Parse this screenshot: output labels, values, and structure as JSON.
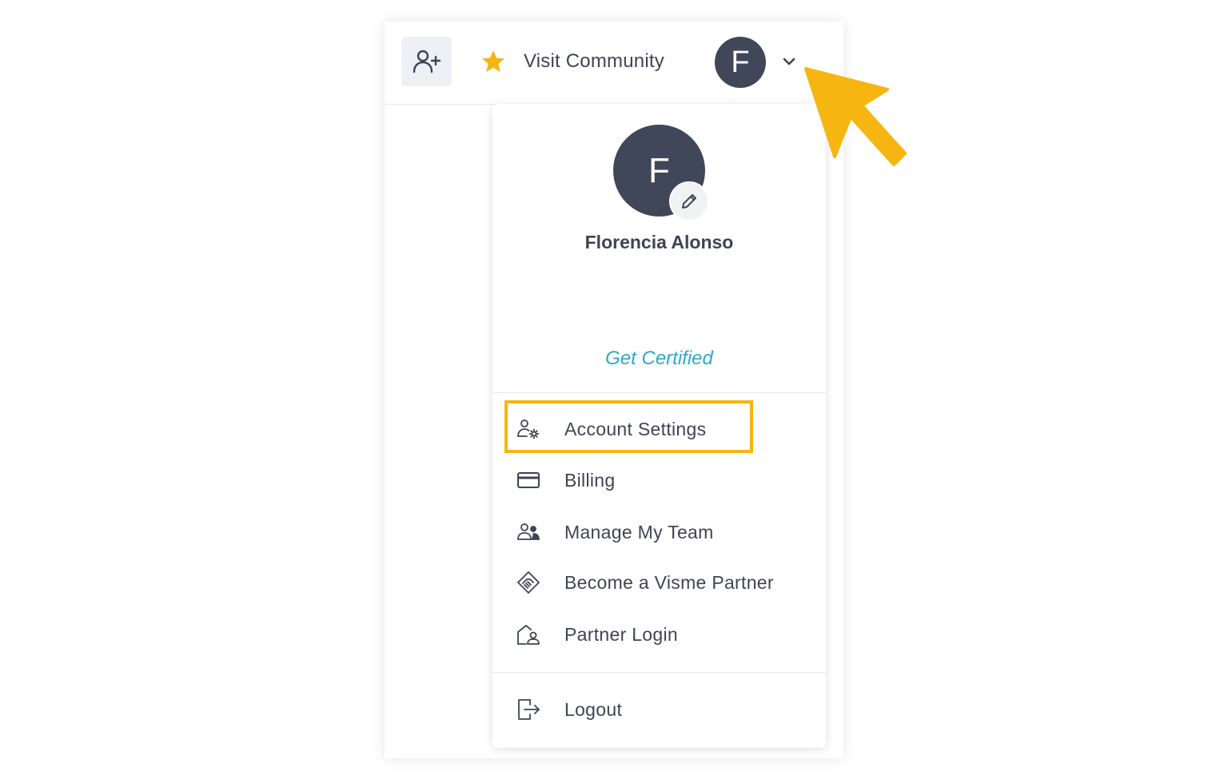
{
  "header": {
    "community_label": "Visit Community",
    "avatar_initial": "F"
  },
  "profile": {
    "avatar_initial": "F",
    "name": "Florencia Alonso",
    "certified_link": "Get Certified"
  },
  "menu": {
    "items": [
      {
        "label": "Account Settings",
        "icon": "user-gear-icon"
      },
      {
        "label": "Billing",
        "icon": "credit-card-icon"
      },
      {
        "label": "Manage My Team",
        "icon": "team-icon"
      },
      {
        "label": "Become a Visme Partner",
        "icon": "handshake-icon"
      },
      {
        "label": "Partner Login",
        "icon": "house-user-icon"
      }
    ],
    "logout_label": "Logout"
  },
  "colors": {
    "accent_highlight": "#f6b511",
    "avatar_bg": "#3f4758",
    "link": "#2fa9c9",
    "text": "#3d4554"
  }
}
